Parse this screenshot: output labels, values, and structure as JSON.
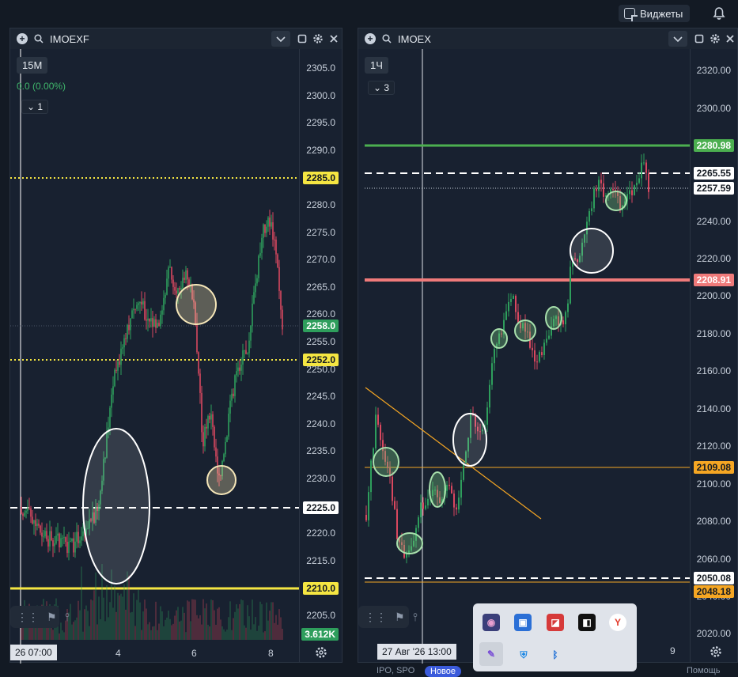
{
  "topbar": {
    "widgets_label": "Виджеты"
  },
  "left": {
    "symbol": "IMOEXF",
    "timeframe": "15M",
    "change": "0.0 (0.00%)",
    "indicator_count": "1",
    "price_ticks": [
      "2305.0",
      "2300.0",
      "2295.0",
      "2290.0",
      "2285.0",
      "2280.0",
      "2275.0",
      "2270.0",
      "2265.0",
      "2260.0",
      "2255.0",
      "2250.0",
      "2245.0",
      "2240.0",
      "2235.0",
      "2230.0",
      "2225.0",
      "2220.0",
      "2215.0",
      "2210.0",
      "2205.0"
    ],
    "labels": [
      {
        "text": "2285.0",
        "bg": "#f5e642",
        "fg": "#141a22"
      },
      {
        "text": "2258.0",
        "bg": "#2e9e5c",
        "fg": "#ffffff"
      },
      {
        "text": "2252.0",
        "bg": "#f5e642",
        "fg": "#141a22"
      },
      {
        "text": "2225.0",
        "bg": "#ffffff",
        "fg": "#141a22"
      },
      {
        "text": "2210.0",
        "bg": "#f5e642",
        "fg": "#141a22"
      },
      {
        "text": "3.612K",
        "bg": "#2e9e5c",
        "fg": "#ffffff"
      }
    ],
    "time_box": "26 07:00",
    "time_ticks": [
      "4",
      "6",
      "8"
    ]
  },
  "right": {
    "symbol": "IMOEX",
    "timeframe": "1Ч",
    "indicator_count": "3",
    "price_ticks": [
      "2320.00",
      "2300.00",
      "2240.00",
      "2220.00",
      "2200.00",
      "2180.00",
      "2160.00",
      "2140.00",
      "2120.00",
      "2100.00",
      "2080.00",
      "2060.00",
      "2040.00",
      "2020.00"
    ],
    "labels": [
      {
        "text": "2280.98",
        "bg": "#4caf50",
        "fg": "#ffffff"
      },
      {
        "text": "2265.55",
        "bg": "#ffffff",
        "fg": "#141a22"
      },
      {
        "text": "2257.59",
        "bg": "#ffffff",
        "fg": "#141a22"
      },
      {
        "text": "2208.91",
        "bg": "#ef7a7a",
        "fg": "#ffffff"
      },
      {
        "text": "2109.08",
        "bg": "#f5a623",
        "fg": "#141a22"
      },
      {
        "text": "2050.08",
        "bg": "#ffffff",
        "fg": "#141a22"
      },
      {
        "text": "2048.18",
        "bg": "#f5a623",
        "fg": "#141a22"
      }
    ],
    "time_box": "27 Авг '26   13:00",
    "time_ticks": [
      "9"
    ]
  },
  "tray": {
    "icons": [
      "app-1",
      "app-2",
      "app-3",
      "app-4",
      "yandex",
      "pen",
      "shield",
      "bluetooth"
    ]
  },
  "bottom": {
    "new_badge": "Новое",
    "items": [
      "IPO, SPO",
      "Помощь"
    ]
  },
  "colors": {
    "up": "#2e9e5c",
    "down": "#d9485f",
    "bg": "#182130"
  }
}
